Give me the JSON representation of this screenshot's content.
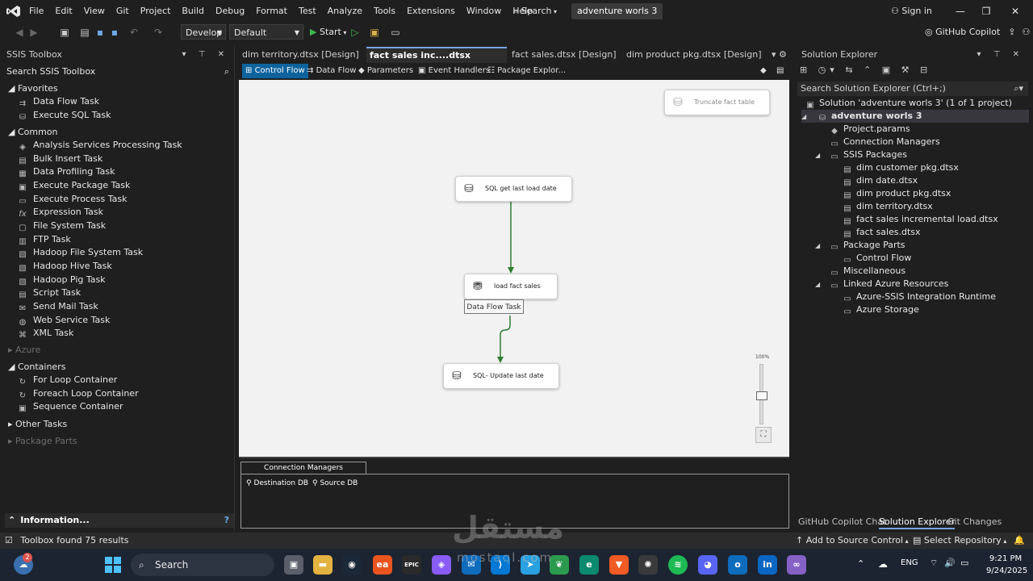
{
  "menubar": {
    "items": [
      "File",
      "Edit",
      "View",
      "Git",
      "Project",
      "Build",
      "Debug",
      "Format",
      "Test",
      "Analyze",
      "Tools",
      "Extensions",
      "Window",
      "Help"
    ],
    "search_label": "Search",
    "solution_name": "adventure worls 3",
    "sign_in": "Sign in"
  },
  "toolbar": {
    "config": "Develop",
    "platform": "Default",
    "start_label": "Start",
    "copilot_label": "GitHub Copilot"
  },
  "toolbox": {
    "title": "SSIS Toolbox",
    "search_label": "Search SSIS Toolbox",
    "groups": {
      "favorites": "Favorites",
      "common": "Common",
      "azure": "Azure",
      "containers": "Containers",
      "other_tasks": "Other Tasks",
      "package_parts": "Package Parts"
    },
    "favorites_items": [
      "Data Flow Task",
      "Execute SQL Task"
    ],
    "common_items": [
      "Analysis Services Processing Task",
      "Bulk Insert Task",
      "Data Profiling Task",
      "Execute Package Task",
      "Execute Process Task",
      "Expression Task",
      "File System Task",
      "FTP Task",
      "Hadoop File System Task",
      "Hadoop Hive Task",
      "Hadoop Pig Task",
      "Script Task",
      "Send Mail Task",
      "Web Service Task",
      "XML Task"
    ],
    "container_items": [
      "For Loop Container",
      "Foreach Loop Container",
      "Sequence Container"
    ],
    "info_label": "Information..."
  },
  "doc_tabs": [
    {
      "label": "dim territory.dtsx [Design]"
    },
    {
      "label": "fact sales inc....dtsx [Design]"
    },
    {
      "label": "fact sales.dtsx [Design]"
    },
    {
      "label": "dim product pkg.dtsx [Design]"
    }
  ],
  "designer_tabs": [
    "Control Flow",
    "Data Flow",
    "Parameters",
    "Event Handlers",
    "Package Explor..."
  ],
  "canvas": {
    "tasks": {
      "truncate": "Truncate fact table",
      "sql_get": "SQL get last load date",
      "load": "load fact sales",
      "sql_update": "SQL- Update last date"
    },
    "tooltip": "Data Flow Task",
    "zoom_level": "100%"
  },
  "connection_managers": {
    "tab_label": "Connection Managers",
    "items": [
      "Destination DB",
      "Source DB"
    ]
  },
  "solution_explorer": {
    "title": "Solution Explorer",
    "search_placeholder": "Search Solution Explorer (Ctrl+;)",
    "solution_line": "Solution 'adventure worls 3' (1 of 1 project)",
    "project": "adventure worls 3",
    "project_params": "Project.params",
    "connection_managers": "Connection Managers",
    "ssis_packages": "SSIS Packages",
    "packages": [
      "dim customer pkg.dtsx",
      "dim date.dtsx",
      "dim product pkg.dtsx",
      "dim territory.dtsx",
      "fact sales incremental load.dtsx",
      "fact sales.dtsx"
    ],
    "package_parts": "Package Parts",
    "control_flow": "Control Flow",
    "miscellaneous": "Miscellaneous",
    "linked_azure": "Linked Azure Resources",
    "azure_items": [
      "Azure-SSIS Integration Runtime",
      "Azure Storage"
    ],
    "bottom_tabs": [
      "GitHub Copilot Chat",
      "Solution Explorer",
      "Git Changes"
    ]
  },
  "statusbar": {
    "message": "Toolbox found 75 results",
    "add_source": "Add to Source Control",
    "select_repo": "Select Repository"
  },
  "taskbar": {
    "search_label": "Search",
    "weather_badge": "2",
    "lang": "ENG",
    "time": "9:21 PM",
    "date": "9/24/2025"
  },
  "watermark": {
    "arabic": "مستقل",
    "latin": "mostaql.com"
  },
  "colors": {
    "accent": "#0e639c",
    "connector": "#2e7d32",
    "canvas_bg": "#f2f2f2",
    "vs_purple": "#8661c5"
  }
}
